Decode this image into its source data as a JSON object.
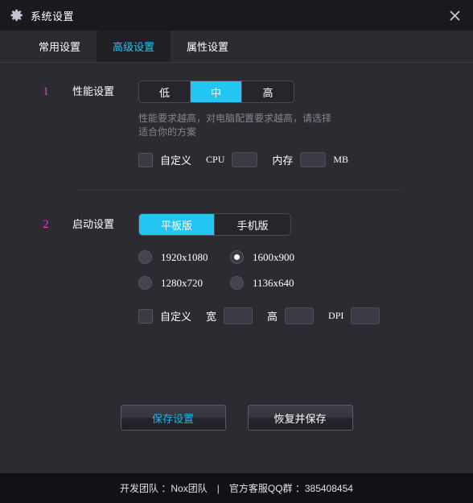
{
  "window": {
    "title": "系统设置",
    "title_icon": "gear-icon",
    "close_icon": "close-icon"
  },
  "tabs": [
    {
      "label": "常用设置",
      "active": false
    },
    {
      "label": "高级设置",
      "active": true
    },
    {
      "label": "属性设置",
      "active": false
    }
  ],
  "sections": [
    {
      "marker": "1",
      "label": "性能设置",
      "segments": [
        {
          "label": "低",
          "active": false
        },
        {
          "label": "中",
          "active": true
        },
        {
          "label": "高",
          "active": false
        }
      ],
      "hint": "性能要求越高，对电脑配置要求越高，请选择适合你的方案",
      "custom_label": "自定义",
      "custom_checked": false,
      "fields": [
        {
          "label": "CPU",
          "value": ""
        },
        {
          "label": "内存",
          "value": "",
          "unit": "MB"
        }
      ]
    },
    {
      "marker": "2",
      "label": "启动设置",
      "segments": [
        {
          "label": "平板版",
          "active": true
        },
        {
          "label": "手机版",
          "active": false
        }
      ],
      "resolutions": [
        {
          "label": "1920x1080",
          "selected": false
        },
        {
          "label": "1600x900",
          "selected": true
        },
        {
          "label": "1280x720",
          "selected": false
        },
        {
          "label": "1136x640",
          "selected": false
        }
      ],
      "custom_label": "自定义",
      "custom_checked": false,
      "fields": [
        {
          "label": "宽",
          "value": ""
        },
        {
          "label": "高",
          "value": ""
        },
        {
          "label": "DPI",
          "value": ""
        }
      ]
    }
  ],
  "buttons": {
    "save": "保存设置",
    "restore": "恢复并保存"
  },
  "footer": {
    "team": "开发团队 ：Nox团队",
    "separator": "|",
    "support": "官方客服QQ群 ：385408454"
  },
  "colors": {
    "accent": "#22c6f0",
    "accent_text": "#29c3ef",
    "marker": "#e03fd8",
    "window_bg": "#2b2b31",
    "titlebar_bg": "#1a1a1e",
    "footer_bg": "#121216"
  }
}
